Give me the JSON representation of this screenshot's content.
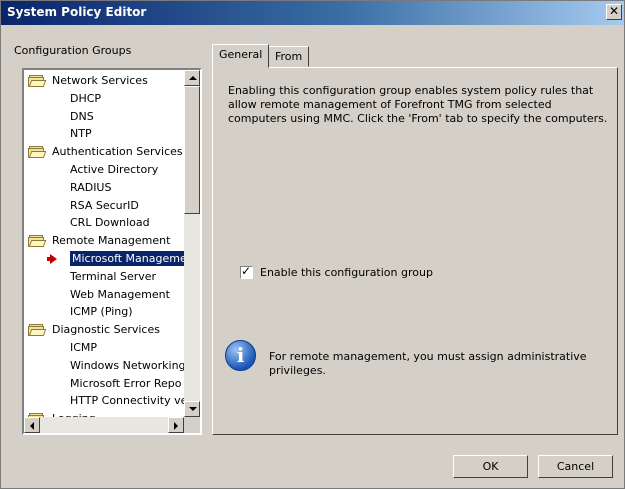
{
  "window": {
    "title": "System Policy Editor",
    "close_glyph": "✕"
  },
  "left": {
    "label": "Configuration Groups",
    "tree": [
      {
        "type": "group",
        "label": "Network Services"
      },
      {
        "type": "child",
        "label": "DHCP"
      },
      {
        "type": "child",
        "label": "DNS"
      },
      {
        "type": "child",
        "label": "NTP"
      },
      {
        "type": "group",
        "label": "Authentication Services"
      },
      {
        "type": "child",
        "label": "Active Directory"
      },
      {
        "type": "child",
        "label": "RADIUS"
      },
      {
        "type": "child",
        "label": "RSA SecurID"
      },
      {
        "type": "child",
        "label": "CRL Download"
      },
      {
        "type": "group",
        "label": "Remote Management"
      },
      {
        "type": "child",
        "label": "Microsoft Manageme",
        "selected": true
      },
      {
        "type": "child",
        "label": "Terminal Server"
      },
      {
        "type": "child",
        "label": "Web Management"
      },
      {
        "type": "child",
        "label": "ICMP (Ping)"
      },
      {
        "type": "group",
        "label": "Diagnostic Services"
      },
      {
        "type": "child",
        "label": "ICMP"
      },
      {
        "type": "child",
        "label": "Windows Networking"
      },
      {
        "type": "child",
        "label": "Microsoft Error Repo"
      },
      {
        "type": "child",
        "label": "HTTP Connectivity ve"
      },
      {
        "type": "group",
        "label": "Logging"
      }
    ]
  },
  "tabs": [
    {
      "label": "General",
      "active": true
    },
    {
      "label": "From",
      "active": false
    }
  ],
  "general": {
    "description": "Enabling this configuration group enables system policy rules that allow remote management of Forefront TMG from selected computers using MMC. Click the 'From' tab to specify the computers.",
    "checkbox_label": "Enable this configuration group",
    "checkbox_checked": true,
    "checkbox_mark": "✓",
    "info_glyph": "i",
    "info_text": "For remote management, you must assign administrative privileges."
  },
  "buttons": {
    "ok": "OK",
    "cancel": "Cancel"
  },
  "icons": {
    "folder": "folder-icon",
    "selection_arrow": "red-arrow-icon",
    "info": "info-icon"
  }
}
